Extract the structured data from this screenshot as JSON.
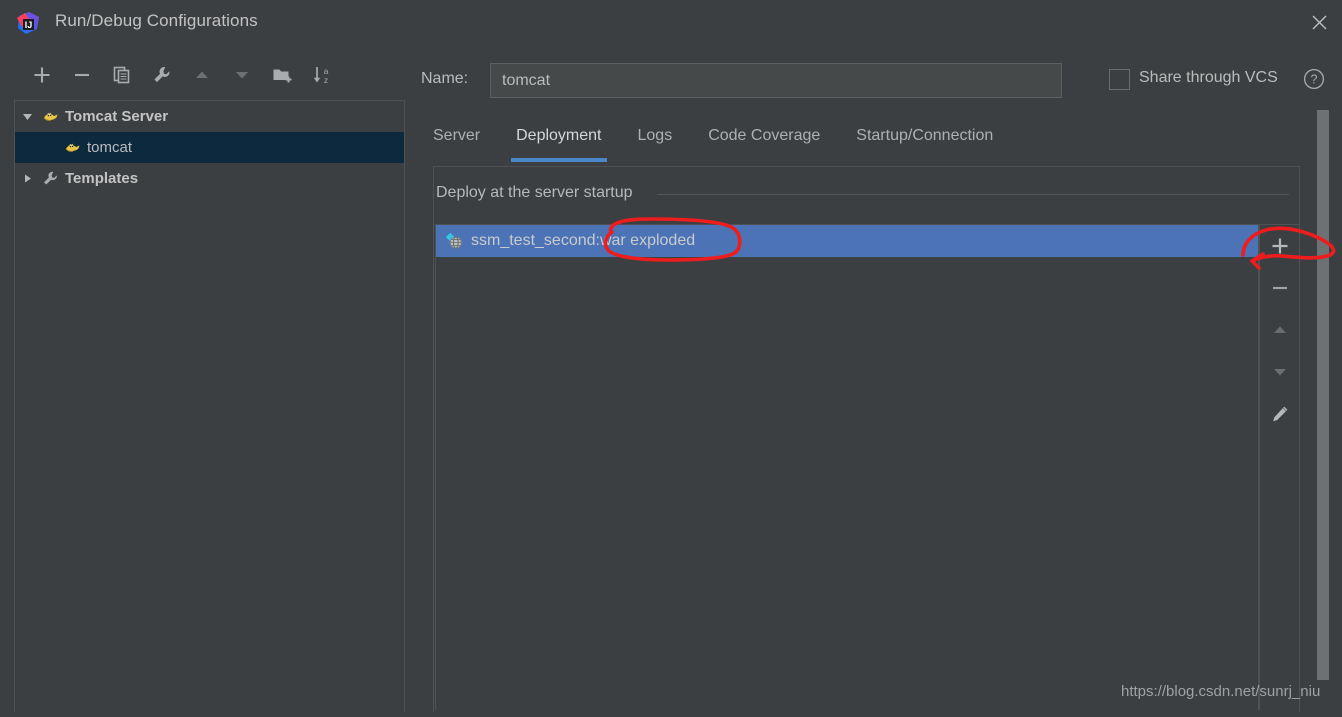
{
  "window": {
    "title": "Run/Debug Configurations",
    "logo_icon": "intellij-idea-logo",
    "close_icon": "close-icon"
  },
  "toolbar": {
    "buttons": [
      {
        "name": "add",
        "icon": "plus-icon",
        "label": "Add New Configuration"
      },
      {
        "name": "remove",
        "icon": "minus-icon",
        "label": "Remove Configuration"
      },
      {
        "name": "copy",
        "icon": "copy-icon",
        "label": "Copy Configuration"
      },
      {
        "name": "edit-templates",
        "icon": "wrench-icon",
        "label": "Edit Templates"
      },
      {
        "name": "move-up",
        "icon": "arrow-up-icon",
        "label": "Move Up"
      },
      {
        "name": "move-down",
        "icon": "arrow-down-icon",
        "label": "Move Down"
      },
      {
        "name": "new-folder",
        "icon": "folder-add-icon",
        "label": "Create New Folder"
      },
      {
        "name": "sort",
        "icon": "sort-alpha-icon",
        "label": "Sort Configurations"
      }
    ]
  },
  "tree": {
    "nodes": [
      {
        "label": "Tomcat Server",
        "icon": "tomcat-icon",
        "expanded": true,
        "arrow": "triangle-down",
        "selected": false,
        "bold": true
      },
      {
        "label": "tomcat",
        "icon": "tomcat-icon",
        "expanded": false,
        "arrow": "",
        "selected": true,
        "bold": false
      },
      {
        "label": "Templates",
        "icon": "wrench-icon",
        "expanded": false,
        "arrow": "triangle-right",
        "selected": false,
        "bold": true
      }
    ]
  },
  "name_row": {
    "label": "Name:",
    "value": "tomcat",
    "placeholder": "",
    "share_label": "Share through VCS",
    "share_checked": false,
    "help_icon": "question-mark-icon"
  },
  "tabs": {
    "items": [
      {
        "label": "Server",
        "active": false
      },
      {
        "label": "Deployment",
        "active": true
      },
      {
        "label": "Logs",
        "active": false
      },
      {
        "label": "Code Coverage",
        "active": false
      },
      {
        "label": "Startup/Connection",
        "active": false
      }
    ]
  },
  "deployment": {
    "section_heading": "Deploy at the server startup",
    "items": [
      {
        "label": "ssm_test_second:war exploded",
        "icon": "artifact-web-icon",
        "selected": true
      }
    ],
    "actions": [
      {
        "name": "add-artifact",
        "icon": "plus-icon",
        "enabled": true
      },
      {
        "name": "remove-artifact",
        "icon": "minus-icon",
        "enabled": true
      },
      {
        "name": "move-artifact-up",
        "icon": "arrow-up-icon",
        "enabled": false
      },
      {
        "name": "move-artifact-down",
        "icon": "arrow-down-icon",
        "enabled": false
      },
      {
        "name": "edit-artifact",
        "icon": "pencil-icon",
        "enabled": true
      }
    ]
  },
  "annotations": {
    "color": "#ee1c1c",
    "circle_target": "war exploded",
    "arrow_target": "add-artifact-button"
  },
  "watermark": {
    "text": "https://blog.csdn.net/sunrj_niu"
  },
  "colors": {
    "window_bg": "#3c3f41",
    "panel_border": "#4e5254",
    "tree_selected_bg": "#0d293e",
    "list_selected_bg": "#4b73b5",
    "tab_underline": "#4a88c7",
    "text": "#bbbbbb",
    "annotation_red": "#ee1c1c"
  }
}
